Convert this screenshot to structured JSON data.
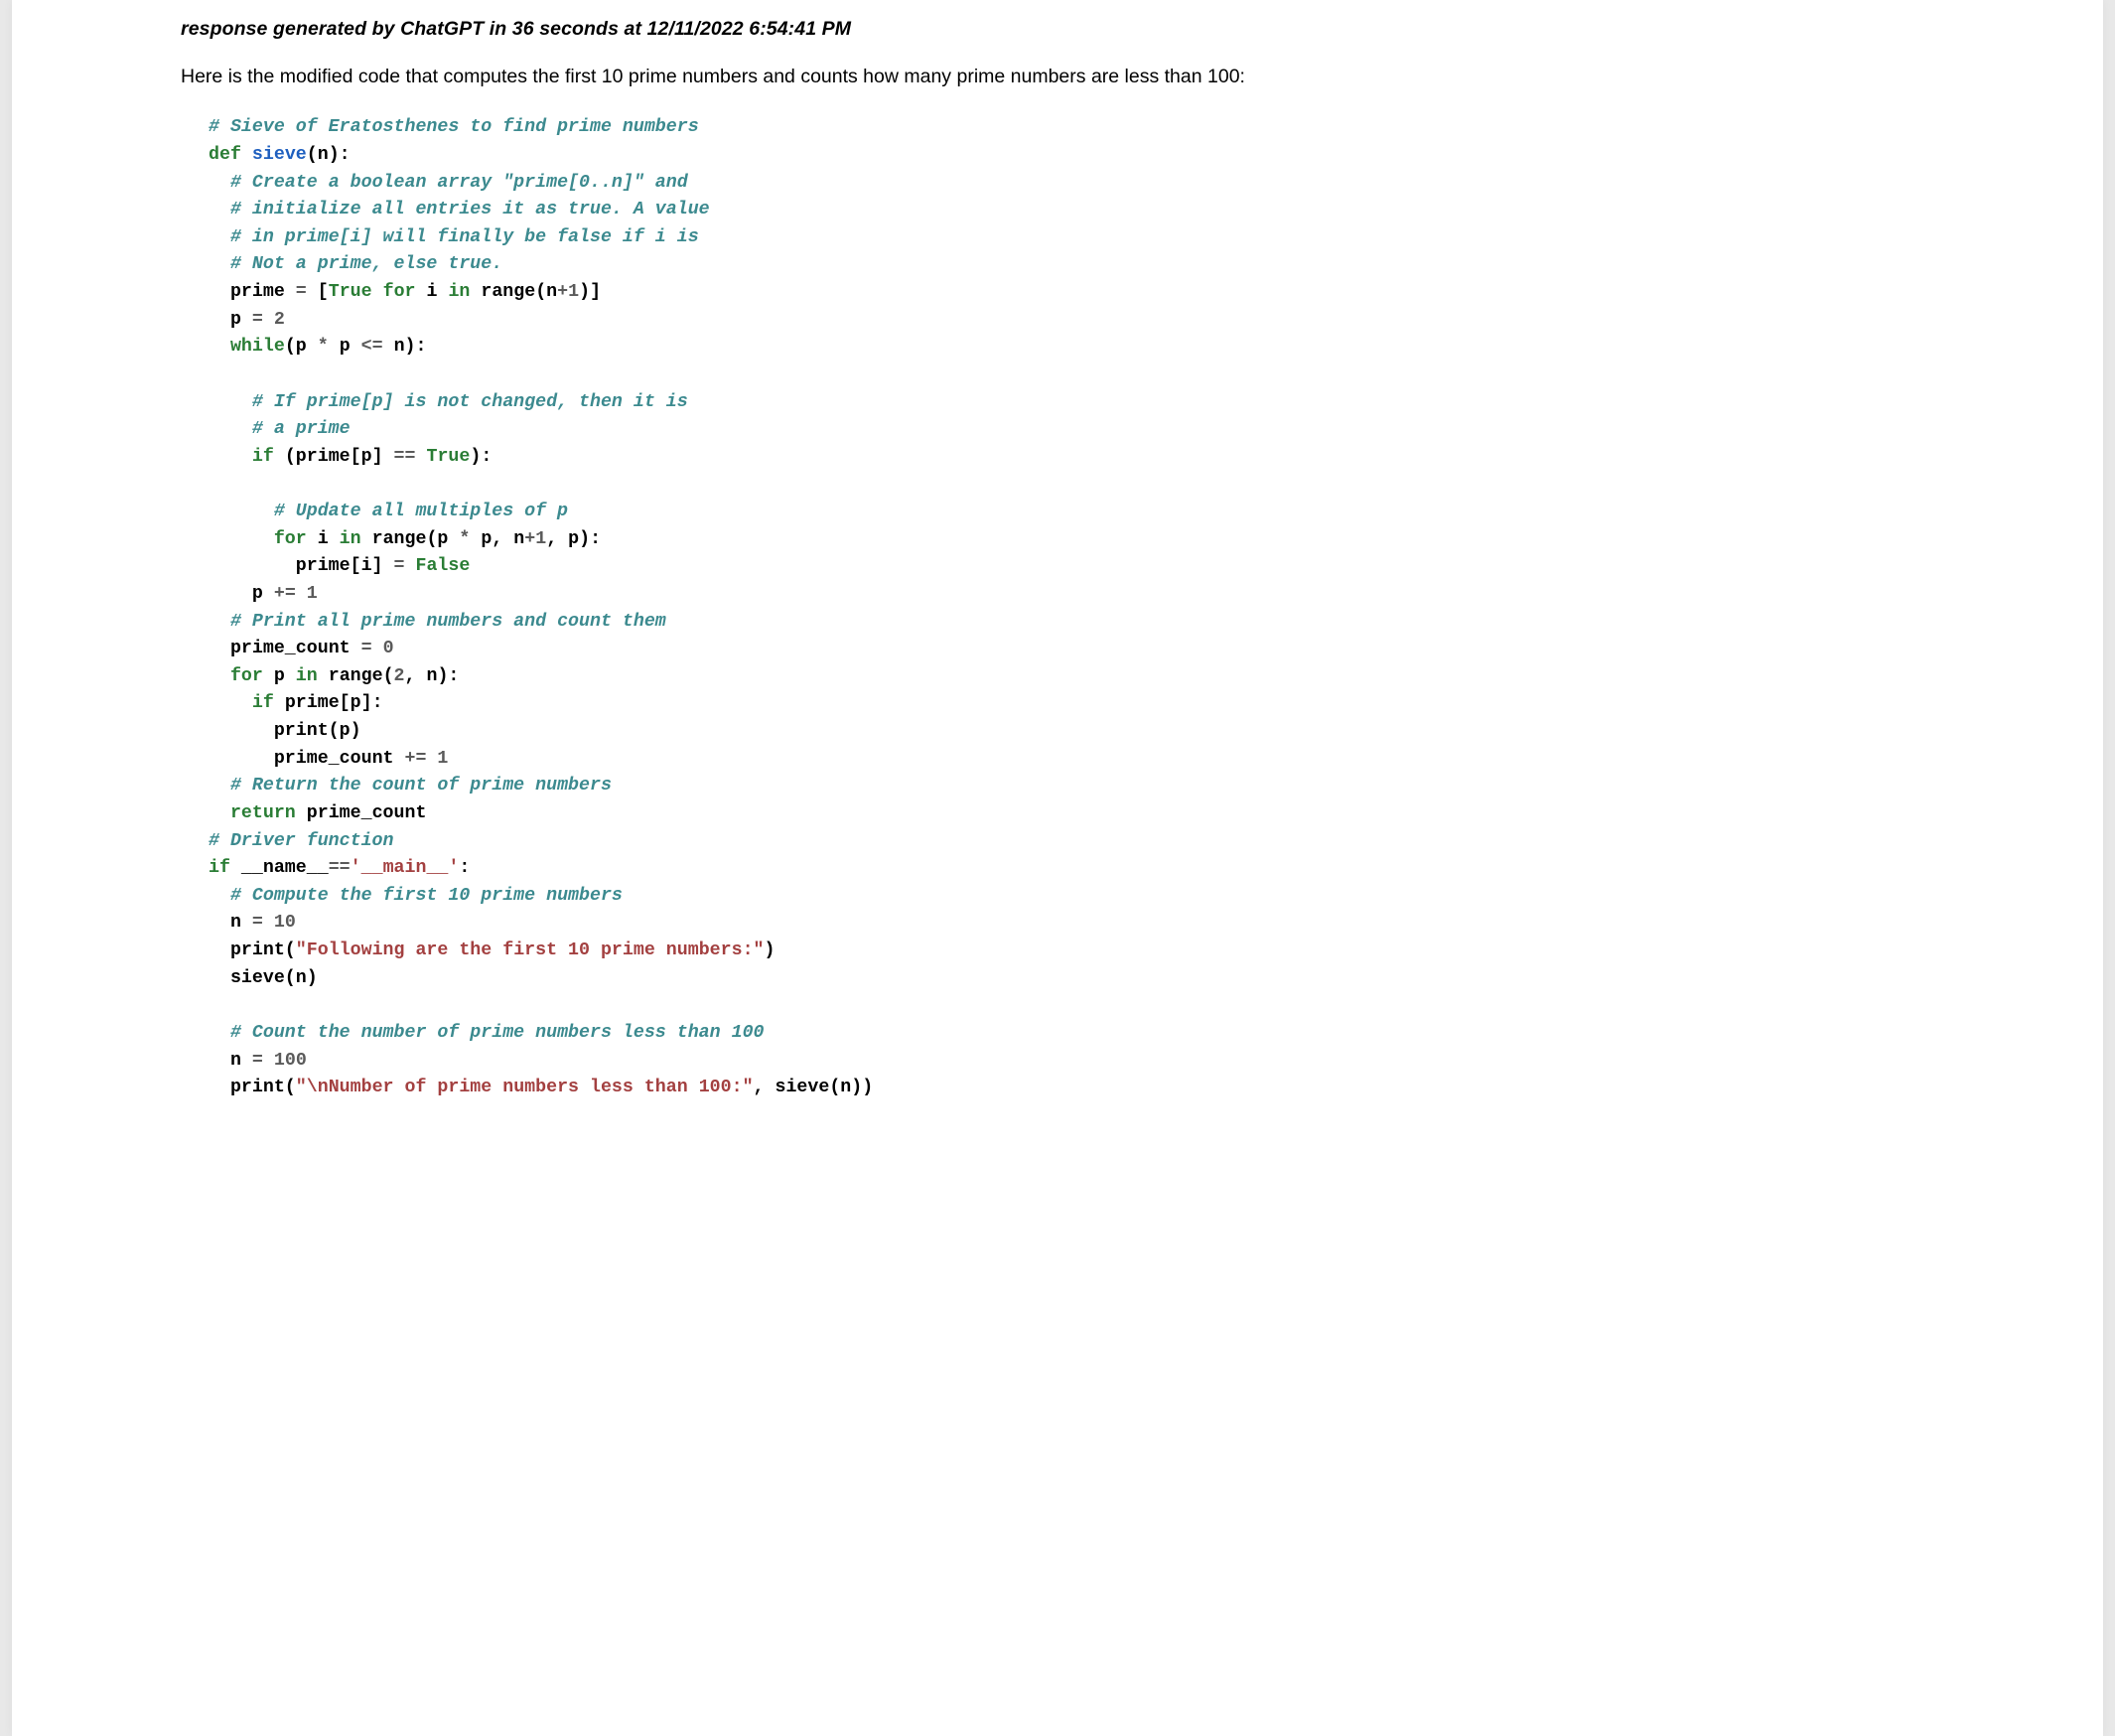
{
  "meta_line": "response generated by ChatGPT in 36 seconds at 12/11/2022 6:54:41 PM",
  "intro_text": "Here is the modified code that computes the first 10 prime numbers and counts how many prime numbers are less than 100:",
  "code": {
    "t01": "# Sieve of Eratosthenes to find prime numbers",
    "t02": "def",
    "t03": "sieve",
    "t04": "(n):",
    "t05": "# Create a boolean array \"prime[0..n]\" and",
    "t06": "# initialize all entries it as true. A value",
    "t07": "# in prime[i] will finally be false if i is",
    "t08": "# Not a prime, else true.",
    "t09": "prime ",
    "t10": "=",
    "t11": " [",
    "t12": "True",
    "t13": " ",
    "t14": "for",
    "t15": " i ",
    "t16": "in",
    "t17": " range(n",
    "t18": "+",
    "t19": "1",
    "t20": ")]",
    "t21": "p ",
    "t22": "=",
    "t23": " ",
    "t24": "2",
    "t25": "while",
    "t26": "(p ",
    "t27": "*",
    "t28": " p ",
    "t29": "<=",
    "t30": " n):",
    "t31": "# If prime[p] is not changed, then it is",
    "t32": "# a prime",
    "t33": "if",
    "t34": " (prime[p] ",
    "t35": "==",
    "t36": " ",
    "t37": "True",
    "t38": "):",
    "t39": "# Update all multiples of p",
    "t40": "for",
    "t41": " i ",
    "t42": "in",
    "t43": " range(p ",
    "t44": "*",
    "t45": " p, n",
    "t46": "+",
    "t47": "1",
    "t48": ", p):",
    "t49": "prime[i] ",
    "t50": "=",
    "t51": " ",
    "t52": "False",
    "t53": "p ",
    "t54": "+=",
    "t55": " ",
    "t56": "1",
    "t57": "# Print all prime numbers and count them",
    "t58": "prime_count ",
    "t59": "=",
    "t60": " ",
    "t61": "0",
    "t62": "for",
    "t63": " p ",
    "t64": "in",
    "t65": " range(",
    "t66": "2",
    "t67": ", n):",
    "t68": "if",
    "t69": " prime[p]:",
    "t70": "print(p)",
    "t71": "prime_count ",
    "t72": "+=",
    "t73": " ",
    "t74": "1",
    "t75": "# Return the count of prime numbers",
    "t76": "return",
    "t77": " prime_count",
    "t78": "# Driver function",
    "t79": "if",
    "t80": " __name__",
    "t81": "==",
    "t82": "'__main__'",
    "t83": ":",
    "t84": "# Compute the first 10 prime numbers",
    "t85": "n ",
    "t86": "=",
    "t87": " ",
    "t88": "10",
    "t89": "print(",
    "t90": "\"Following are the first 10 prime numbers:\"",
    "t91": ")",
    "t92": "sieve(n)",
    "t93": "# Count the number of prime numbers less than 100",
    "t94": "n ",
    "t95": "=",
    "t96": " ",
    "t97": "100",
    "t98": "print(",
    "t99": "\"\\nNumber of prime numbers less than 100:\"",
    "t100": ", sieve(n))"
  }
}
